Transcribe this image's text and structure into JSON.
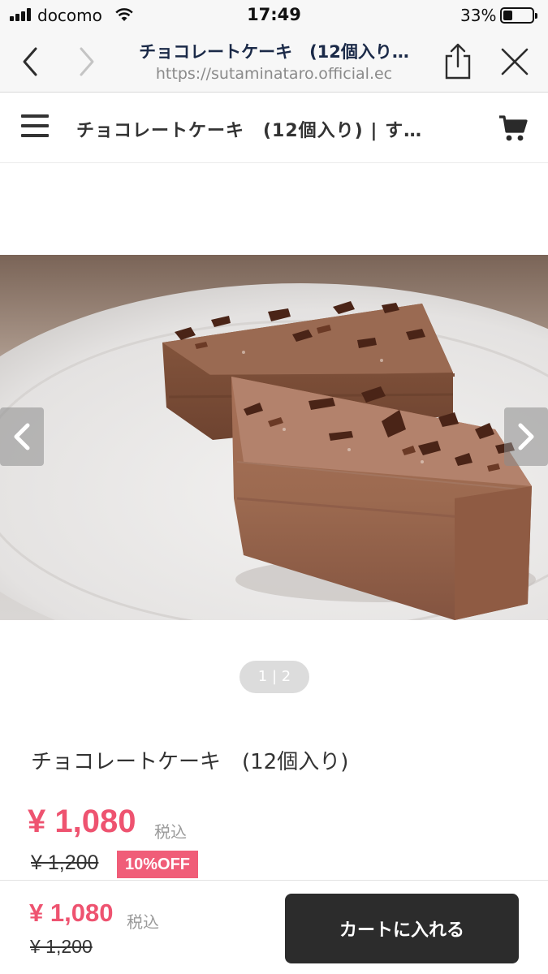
{
  "status_bar": {
    "carrier": "docomo",
    "time": "17:49",
    "battery_percent": "33%",
    "battery_level": 0.33
  },
  "browser": {
    "page_title": "チョコレートケーキ　(12個入り…",
    "url": "https://sutaminataro.official.ec",
    "icons": [
      "back-icon",
      "forward-icon",
      "share-icon",
      "close-icon"
    ]
  },
  "site_header": {
    "title": "チョコレートケーキ　(12個入り) | す…",
    "icons": [
      "menu-icon",
      "cart-icon"
    ]
  },
  "gallery": {
    "image_alt": "product photo",
    "page_indicator": "1 | 2",
    "current_page": 1,
    "total_pages": 2
  },
  "product": {
    "name": "チョコレートケーキ　(12個入り)",
    "price": "¥ 1,080",
    "tax_label": "税込",
    "original_price": "¥ 1,200",
    "discount": "10%OFF"
  },
  "bottom_bar": {
    "price": "¥ 1,080",
    "tax_label": "税込",
    "original_price": "¥ 1,200",
    "cart_button_label": "カートに入れる"
  },
  "colors": {
    "price_accent": "#ee5370",
    "discount_badge": "#f05d78",
    "cart_button": "#2c2c2c",
    "browser_title": "#1b2a48"
  }
}
